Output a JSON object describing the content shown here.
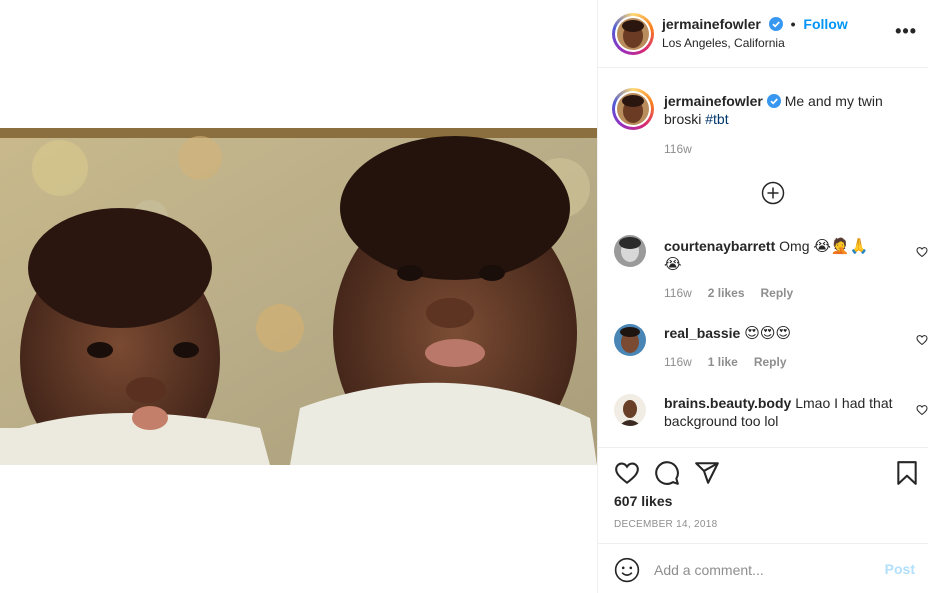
{
  "post": {
    "author": "jermainefowler",
    "follow_label": "Follow",
    "dot": "•",
    "location": "Los Angeles, California",
    "more_label": "•••",
    "caption_user": "jermainefowler",
    "caption_text": " Me and my twin broski ",
    "caption_hashtag": "#tbt",
    "caption_age": "116w",
    "likes": "607 likes",
    "date": "December 14, 2018",
    "verified_color": "#3897f0",
    "accent": "#0095f6"
  },
  "comments": [
    {
      "user": "courtenaybarrett",
      "text": " Omg ",
      "emojis": "😭🤦🙏",
      "emojis2": "😭",
      "age": "116w",
      "likes": "2 likes",
      "reply": "Reply"
    },
    {
      "user": "real_bassie",
      "text": " ",
      "emojis": "😍😍😍",
      "age": "116w",
      "likes": "1 like",
      "reply": "Reply"
    },
    {
      "user": "brains.beauty.body",
      "text": " Lmao I had that background too lol"
    }
  ],
  "add_comment": {
    "placeholder": "Add a comment...",
    "post_label": "Post"
  },
  "icons": {
    "like": "heart-icon",
    "comment": "comment-bubble-icon",
    "share": "paper-plane-icon",
    "save": "bookmark-icon",
    "emoji": "smiley-icon",
    "load_more": "plus-circle-icon",
    "more": "ellipsis-icon"
  }
}
